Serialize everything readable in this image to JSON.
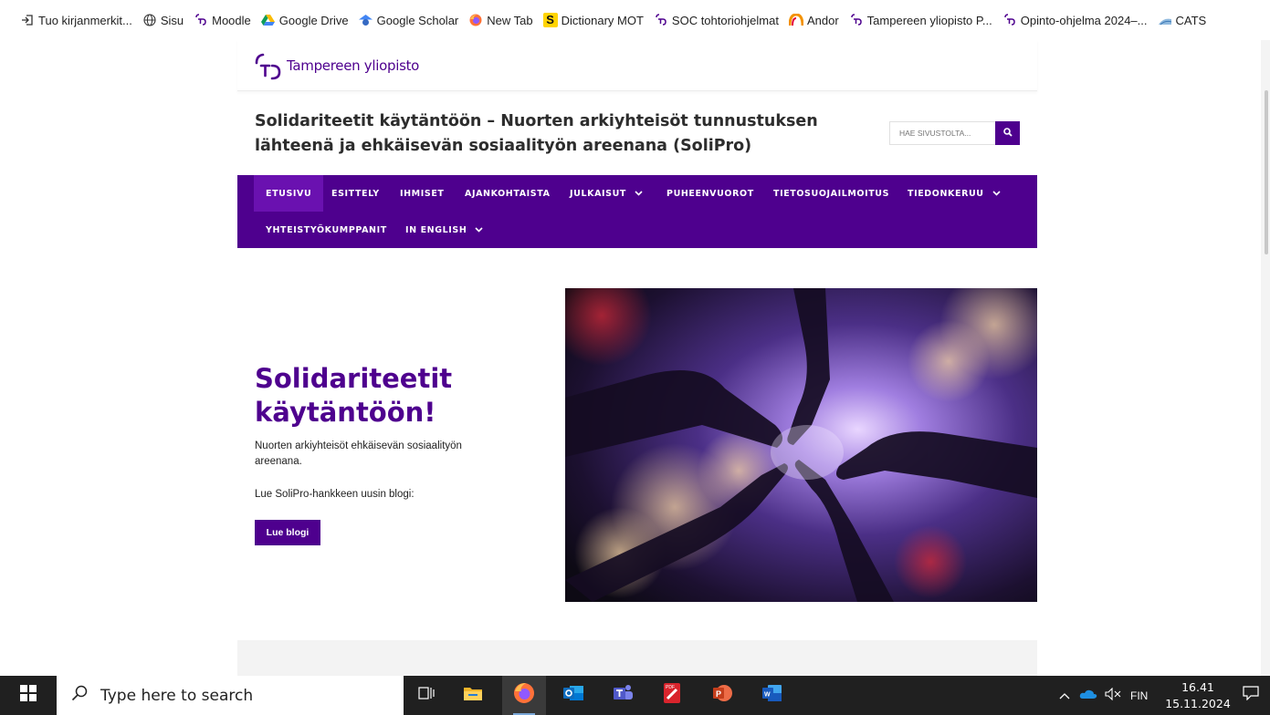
{
  "bookmarks": [
    {
      "label": "Tuo kirjanmerkit...",
      "icon": "import-icon"
    },
    {
      "label": "Sisu",
      "icon": "globe-icon"
    },
    {
      "label": "Moodle",
      "icon": "tuni-logo-icon"
    },
    {
      "label": "Google Drive",
      "icon": "google-drive-icon"
    },
    {
      "label": "Google Scholar",
      "icon": "google-scholar-icon"
    },
    {
      "label": "New Tab",
      "icon": "firefox-icon"
    },
    {
      "label": "Dictionary MOT",
      "icon": "mot-s-icon"
    },
    {
      "label": "SOC tohtoriohjelmat",
      "icon": "tuni-logo-icon"
    },
    {
      "label": "Andor",
      "icon": "andor-icon"
    },
    {
      "label": "Tampereen yliopisto P...",
      "icon": "tuni-logo-icon"
    },
    {
      "label": "Opinto-ohjelma 2024–...",
      "icon": "tuni-logo-icon"
    },
    {
      "label": "CATS",
      "icon": "cats-icon"
    }
  ],
  "site": {
    "logo_text": "Tampereen yliopisto",
    "title": "Solidariteetit käytäntöön – Nuorten arkiyhteisöt tunnustuksen lähteenä ja ehkäisevän sosiaalityön areenana (SoliPro)",
    "search_placeholder": "HAE SIVUSTOLTA...",
    "nav": [
      {
        "label": "ETUSIVU",
        "active": true,
        "dropdown": false
      },
      {
        "label": "ESITTELY",
        "active": false,
        "dropdown": false
      },
      {
        "label": "IHMISET",
        "active": false,
        "dropdown": false
      },
      {
        "label": "AJANKOHTAISTA",
        "active": false,
        "dropdown": false
      },
      {
        "label": "JULKAISUT",
        "active": false,
        "dropdown": true
      },
      {
        "label": "PUHEENVUOROT",
        "active": false,
        "dropdown": false
      },
      {
        "label": "TIETOSUOJAILMOITUS",
        "active": false,
        "dropdown": false
      },
      {
        "label": "TIEDONKERUU",
        "active": false,
        "dropdown": true
      },
      {
        "label": "YHTEISTYÖKUMPPANIT",
        "active": false,
        "dropdown": false
      },
      {
        "label": "IN ENGLISH",
        "active": false,
        "dropdown": true
      }
    ],
    "hero": {
      "title": "Solidariteetit käytäntöön!",
      "description": "Nuorten arkiyhteisöt ehkäisevän sosiaalityön areenana.",
      "note": "Lue SoliPro-hankkeen uusin blogi:",
      "button_label": "Lue blogi"
    }
  },
  "taskbar": {
    "search_placeholder": "Type here to search",
    "apps": [
      "task-view-icon",
      "file-explorer-icon",
      "firefox-icon",
      "outlook-icon",
      "teams-icon",
      "pdf-reader-icon",
      "powerpoint-icon",
      "word-icon"
    ],
    "language": "FIN",
    "time": "16.41",
    "date": "15.11.2024"
  },
  "colors": {
    "brand_purple": "#4e008e",
    "nav_active": "#6a11b0",
    "taskbar": "#202020"
  }
}
